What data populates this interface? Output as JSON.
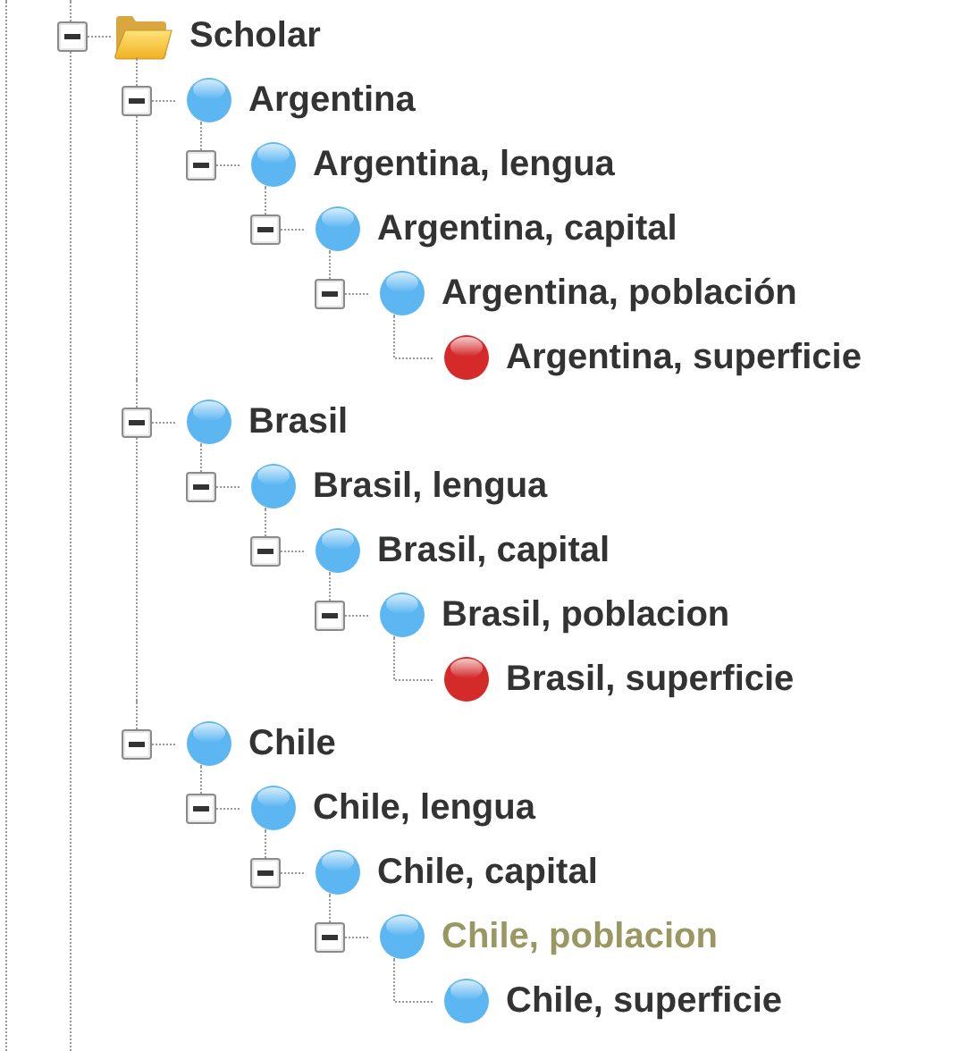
{
  "tree": [
    {
      "label": "Scholar",
      "kind": "folder",
      "expanded": true,
      "selected": false,
      "children": [
        {
          "label": "Argentina",
          "kind": "item",
          "color": "#5cb6f2",
          "expanded": true,
          "selected": false,
          "children": [
            {
              "label": "Argentina, lengua",
              "kind": "item",
              "color": "#5cb6f2",
              "expanded": true,
              "selected": false,
              "children": [
                {
                  "label": "Argentina, capital",
                  "kind": "item",
                  "color": "#5cb6f2",
                  "expanded": true,
                  "selected": false,
                  "children": [
                    {
                      "label": "Argentina, población",
                      "kind": "item",
                      "color": "#5cb6f2",
                      "expanded": true,
                      "selected": false,
                      "children": [
                        {
                          "label": "Argentina, superficie",
                          "kind": "item",
                          "color": "#d42a2a",
                          "selected": false
                        }
                      ]
                    }
                  ]
                }
              ]
            }
          ]
        },
        {
          "label": "Brasil",
          "kind": "item",
          "color": "#5cb6f2",
          "expanded": true,
          "selected": false,
          "children": [
            {
              "label": "Brasil, lengua",
              "kind": "item",
              "color": "#5cb6f2",
              "expanded": true,
              "selected": false,
              "children": [
                {
                  "label": "Brasil, capital",
                  "kind": "item",
                  "color": "#5cb6f2",
                  "expanded": true,
                  "selected": false,
                  "children": [
                    {
                      "label": "Brasil, poblacion",
                      "kind": "item",
                      "color": "#5cb6f2",
                      "expanded": true,
                      "selected": false,
                      "children": [
                        {
                          "label": "Brasil, superficie",
                          "kind": "item",
                          "color": "#d42a2a",
                          "selected": false
                        }
                      ]
                    }
                  ]
                }
              ]
            }
          ]
        },
        {
          "label": "Chile",
          "kind": "item",
          "color": "#5cb6f2",
          "expanded": true,
          "selected": false,
          "children": [
            {
              "label": "Chile, lengua",
              "kind": "item",
              "color": "#5cb6f2",
              "expanded": true,
              "selected": false,
              "children": [
                {
                  "label": "Chile, capital",
                  "kind": "item",
                  "color": "#5cb6f2",
                  "expanded": true,
                  "selected": false,
                  "children": [
                    {
                      "label": "Chile, poblacion",
                      "kind": "item",
                      "color": "#5cb6f2",
                      "expanded": true,
                      "selected": true,
                      "children": [
                        {
                          "label": "Chile, superficie",
                          "kind": "item",
                          "color": "#5cb6f2",
                          "selected": false
                        }
                      ]
                    }
                  ]
                }
              ]
            }
          ]
        }
      ]
    }
  ]
}
